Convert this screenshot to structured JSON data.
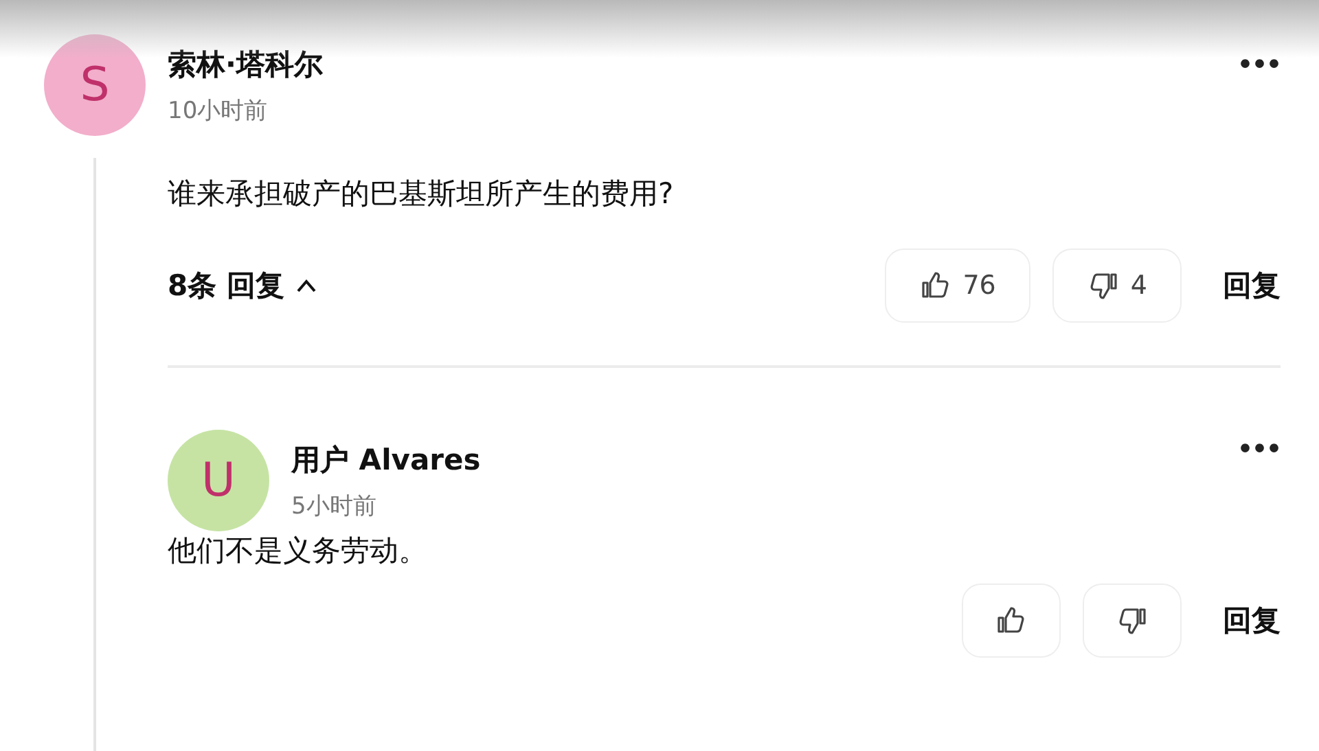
{
  "comment": {
    "avatar": {
      "letter": "S",
      "color": "#f2aecb"
    },
    "author": "索林·塔科尔",
    "time": "10小时前",
    "menu": "•••",
    "text": "谁来承担破产的巴基斯坦所产生的费用?",
    "replies_toggle": {
      "label": "8条 回复",
      "expanded": true
    },
    "likes": "76",
    "dislikes": "4",
    "reply_label": "回复",
    "replies": [
      {
        "avatar": {
          "letter": "U",
          "color": "#c6e3a4"
        },
        "author": "用户 Alvares",
        "time": "5小时前",
        "menu": "•••",
        "text": "他们不是义务劳动。",
        "reply_label": "回复"
      }
    ]
  }
}
